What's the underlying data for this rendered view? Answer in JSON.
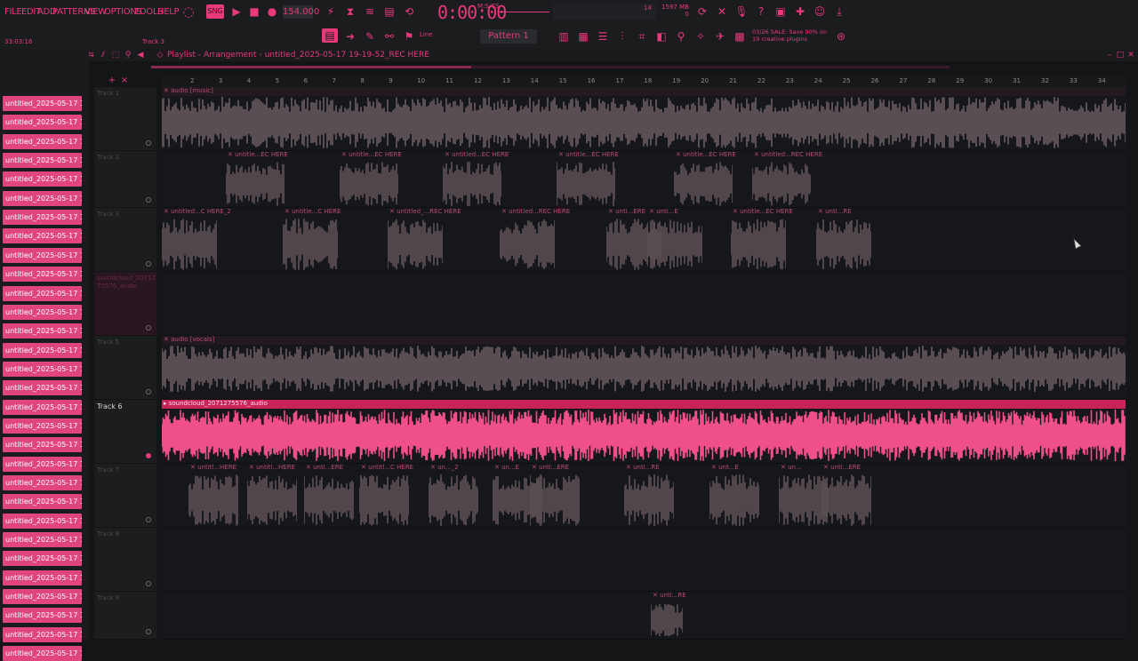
{
  "menu": [
    "FILE",
    "EDIT",
    "ADD",
    "PATTERNS",
    "VIEW",
    "OPTIONS",
    "TOOLS",
    "HELP"
  ],
  "hint": {
    "time_left": "33:03:16",
    "track_hint": "Track 3"
  },
  "transport": {
    "tempo": "154.000",
    "time": "0:00:00",
    "time_suffix": "M:S:CS",
    "mem1": "14",
    "mem2": "1597 MB",
    "mem3": "0"
  },
  "toolbar": {
    "line_label": "Line",
    "pattern_label": "Pattern 1"
  },
  "news": {
    "line1": "03/26  SALE: Save 90% on",
    "line2": "19 creative plugins"
  },
  "playlist": {
    "title": "Playlist - Arrangement",
    "project": "untitled_2025-05-17 19-19-52_REC HERE"
  },
  "browser_items": [
    "untitled_2025-05-17 19-...",
    "untitled_2025-05-17 19-...",
    "untitled_2025-05-17 19-...",
    "untitled_2025-05-17 19-...",
    "untitled_2025-05-17 19-...",
    "untitled_2025-05-17 19-...",
    "untitled_2025-05-17 19-...",
    "untitled_2025-05-17 19-...",
    "untitled_2025-05-17 19-...",
    "untitled_2025-05-17 19-...",
    "untitled_2025-05-17 19-...",
    "untitled_2025-05-17 19-...",
    "untitled_2025-05-17 19-...",
    "untitled_2025-05-17 19-...",
    "untitled_2025-05-17 19-...",
    "untitled_2025-05-17 19-...",
    "untitled_2025-05-17 19-...",
    "untitled_2025-05-17 19-...",
    "untitled_2025-05-17 19-...",
    "untitled_2025-05-17 19-...",
    "untitled_2025-05-17 19-...",
    "untitled_2025-05-17 19-...",
    "untitled_2025-05-17 19-...",
    "untitled_2025-05-17 19-...",
    "untitled_2025-05-17 19-...",
    "untitled_2025-05-17 19-...",
    "untitled_2025-05-17 19-...",
    "untitled_2025-05-17 19-...",
    "untitled_2025-05-17 19-...",
    "untitled_2025-05-17 19-..."
  ],
  "ruler": [
    "2",
    "3",
    "4",
    "5",
    "6",
    "7",
    "8",
    "9",
    "10",
    "11",
    "12",
    "13",
    "14",
    "15",
    "16",
    "17",
    "18",
    "19",
    "20",
    "21",
    "22",
    "23",
    "24",
    "25",
    "26",
    "27",
    "28",
    "29",
    "30",
    "31",
    "32",
    "33",
    "34"
  ],
  "tracks": [
    {
      "name": "Track 1",
      "clips": [
        {
          "label": "audio [music]",
          "style": "full"
        }
      ]
    },
    {
      "name": "Track 2",
      "clips": [
        {
          "label": "untitle...EC HERE"
        },
        {
          "label": "untitle...EC HERE"
        },
        {
          "label": "untitled...EC HERE"
        },
        {
          "label": "untitle...EC HERE"
        },
        {
          "label": "untitle...EC HERE"
        },
        {
          "label": "untitled...REC HERE"
        }
      ]
    },
    {
      "name": "Track 3",
      "clips": [
        {
          "label": "untitled...C HERE_2"
        },
        {
          "label": "untitle...C HERE"
        },
        {
          "label": "untitled_...REC HERE"
        },
        {
          "label": "untitled...REC HERE"
        },
        {
          "label": "unti...ERE"
        },
        {
          "label": "unti...E"
        },
        {
          "label": "untitle...EC HERE"
        },
        {
          "label": "unti...RE"
        }
      ]
    },
    {
      "name": "soundcloud_20712 75576_audio",
      "clips": []
    },
    {
      "name": "Track 5",
      "clips": [
        {
          "label": "audio [vocals]",
          "style": "full"
        }
      ]
    },
    {
      "name": "Track 6",
      "clips": [
        {
          "label": "soundcloud_2071275576_audio",
          "style": "active"
        }
      ]
    },
    {
      "name": "Track 7",
      "clips": [
        {
          "label": "untitl...HERE"
        },
        {
          "label": "untitl...HERE"
        },
        {
          "label": "unti...ERE"
        },
        {
          "label": "untitl...C HERE"
        },
        {
          "label": "un..._2"
        },
        {
          "label": "un...E"
        },
        {
          "label": "unti...ERE"
        },
        {
          "label": "unti...RE"
        },
        {
          "label": "unt...E"
        },
        {
          "label": "un..."
        },
        {
          "label": "unti...ERE"
        }
      ]
    },
    {
      "name": "Track 8",
      "clips": []
    },
    {
      "name": "Track 9",
      "clips": [
        {
          "label": "unti...RE"
        }
      ]
    }
  ],
  "colors": {
    "accent": "#e83a7a",
    "clip_active": "#f0508a",
    "clip_dim": "#5a4a50",
    "bg": "#141516"
  }
}
